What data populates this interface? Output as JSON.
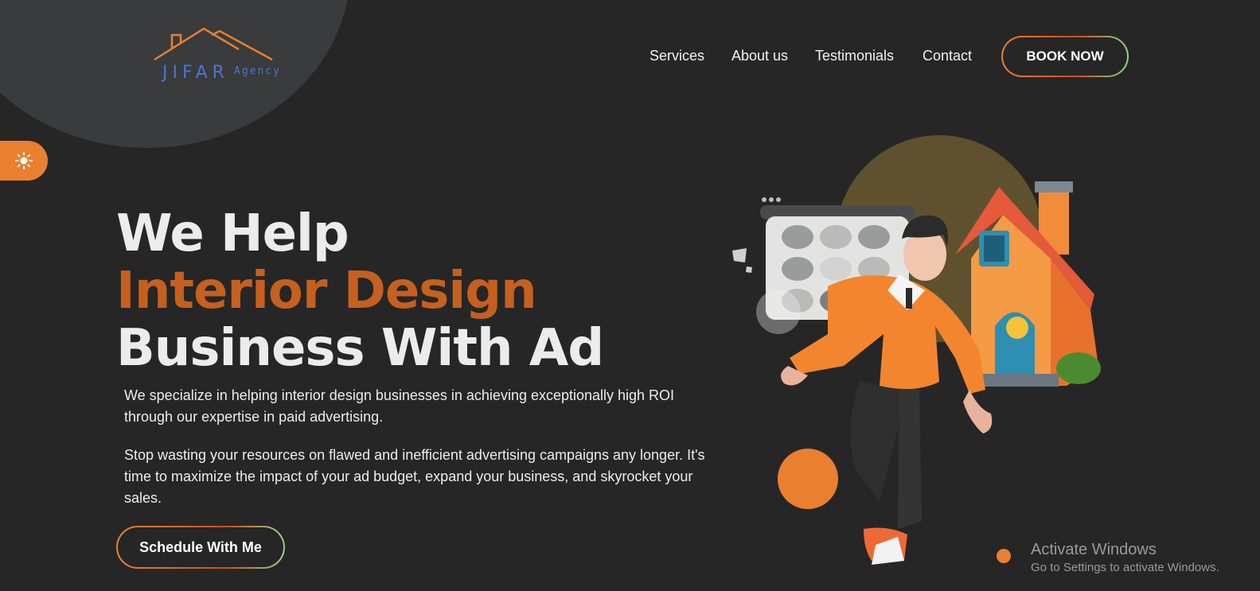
{
  "logo": {
    "main": "JIFAR",
    "sub": "Agency"
  },
  "nav": {
    "links": [
      "Services",
      "About us",
      "Testimonials",
      "Contact"
    ],
    "book_label": "BOOK NOW"
  },
  "theme_toggle": {
    "icon": "sun-icon"
  },
  "hero": {
    "line1": "We Help",
    "line2": "Interior Design",
    "line3": "Business With Ad",
    "desc1": "We specialize in helping interior design businesses in achieving exceptionally high ROI through our expertise in paid advertising.",
    "desc2": "Stop wasting your resources on flawed and inefficient advertising campaigns any longer. It's time to maximize the impact of your ad budget, expand your business, and skyrocket your sales.",
    "cta_label": "Schedule With Me"
  },
  "watermark": {
    "title": "Activate Windows",
    "subtitle": "Go to Settings to activate Windows."
  },
  "colors": {
    "background": "#262626",
    "accent": "#ea7f2f",
    "accent_dark": "#c5601f",
    "logo_blue": "#4a76d1",
    "olive_circle": "#5f512e"
  }
}
